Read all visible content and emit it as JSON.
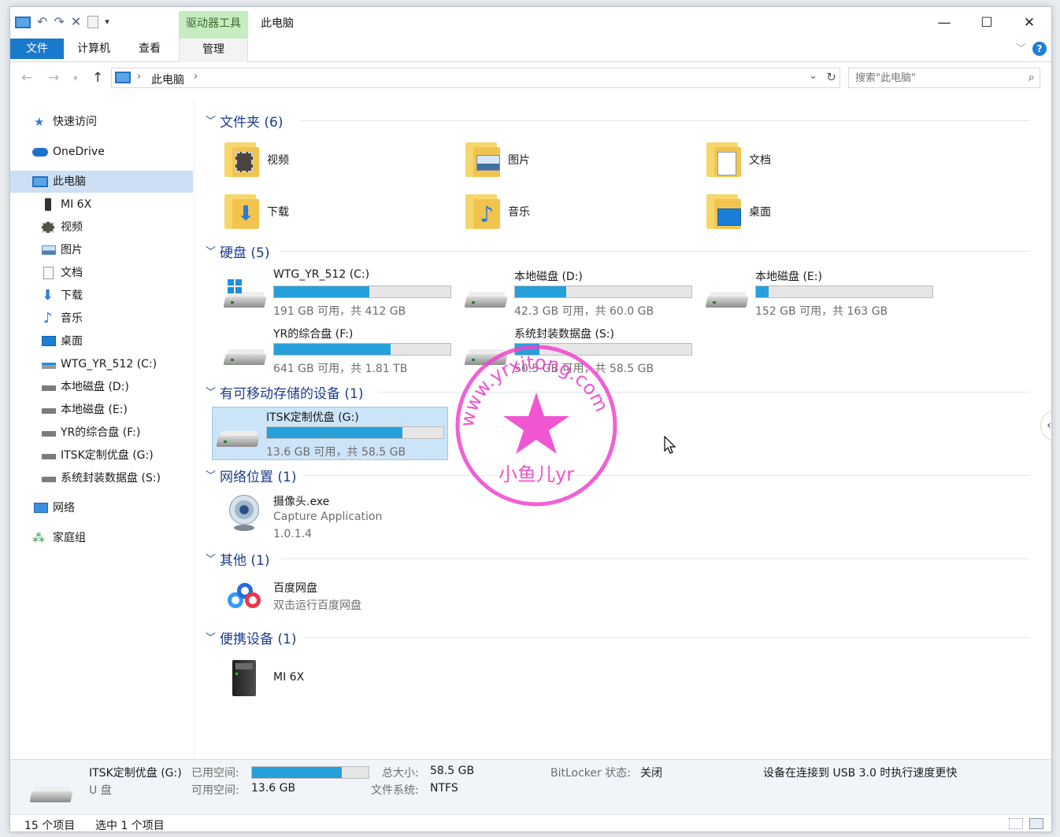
{
  "title_bar": {
    "context_tab": "驱动器工具",
    "window_title": "此电脑",
    "minimize_label": "—",
    "maximize_label": "☐",
    "close_label": "✕"
  },
  "ribbon": {
    "file": "文件",
    "computer": "计算机",
    "view": "查看",
    "manage": "管理",
    "help": "?"
  },
  "address": {
    "crumb": "此电脑",
    "search_placeholder": "搜索\"此电脑\""
  },
  "sidebar": {
    "items": [
      {
        "label": "快速访问"
      },
      {
        "label": "OneDrive"
      },
      {
        "label": "此电脑"
      },
      {
        "label": "MI 6X"
      },
      {
        "label": "视频"
      },
      {
        "label": "图片"
      },
      {
        "label": "文档"
      },
      {
        "label": "下载"
      },
      {
        "label": "音乐"
      },
      {
        "label": "桌面"
      },
      {
        "label": "WTG_YR_512 (C:)"
      },
      {
        "label": "本地磁盘 (D:)"
      },
      {
        "label": "本地磁盘 (E:)"
      },
      {
        "label": "YR的综合盘 (F:)"
      },
      {
        "label": "ITSK定制优盘 (G:)"
      },
      {
        "label": "系统封装数据盘 (S:)"
      },
      {
        "label": "网络"
      },
      {
        "label": "家庭组"
      }
    ]
  },
  "groups": {
    "folders": "文件夹 (6)",
    "disks": "硬盘 (5)",
    "removable": "有可移动存储的设备 (1)",
    "network": "网络位置 (1)",
    "other": "其他 (1)",
    "portable": "便携设备 (1)"
  },
  "folders": [
    {
      "label": "视频",
      "icon": "video-folder-icon"
    },
    {
      "label": "图片",
      "icon": "pictures-folder-icon"
    },
    {
      "label": "文档",
      "icon": "documents-folder-icon"
    },
    {
      "label": "下载",
      "icon": "downloads-folder-icon"
    },
    {
      "label": "音乐",
      "icon": "music-folder-icon"
    },
    {
      "label": "桌面",
      "icon": "desktop-folder-icon"
    }
  ],
  "drives": [
    {
      "name": "WTG_YR_512 (C:)",
      "size": "191 GB 可用，共 412 GB",
      "used_fraction": 0.54
    },
    {
      "name": "本地磁盘 (D:)",
      "size": "42.3 GB 可用，共 60.0 GB",
      "used_fraction": 0.29
    },
    {
      "name": "本地磁盘 (E:)",
      "size": "152 GB 可用，共 163 GB",
      "used_fraction": 0.07
    },
    {
      "name": "YR的综合盘 (F:)",
      "size": "641 GB 可用，共 1.81 TB",
      "used_fraction": 0.66
    },
    {
      "name": "系统封装数据盘 (S:)",
      "size": "50.5 GB 可用，共 58.5 GB",
      "used_fraction": 0.14
    }
  ],
  "removable": {
    "name": "ITSK定制优盘 (G:)",
    "size": "13.6 GB 可用，共 58.5 GB",
    "used_fraction": 0.77
  },
  "network_item": {
    "name": "摄像头.exe",
    "desc": "Capture Application",
    "version": "1.0.1.4"
  },
  "other_item": {
    "name": "百度网盘",
    "desc": "双击运行百度网盘"
  },
  "portable_item": {
    "name": "MI 6X"
  },
  "details": {
    "name": "ITSK定制优盘 (G:)",
    "type": "U 盘",
    "used_label": "已用空间:",
    "free_label": "可用空间:",
    "free_value": "13.6 GB",
    "total_label": "总大小:",
    "total_value": "58.5 GB",
    "fs_label": "文件系统:",
    "fs_value": "NTFS",
    "bitlocker_label": "BitLocker 状态:",
    "bitlocker_value": "关闭",
    "usb_note": "设备在连接到 USB 3.0 时执行速度更快",
    "used_fraction": 0.77
  },
  "status": {
    "count": "15 个项目",
    "selected": "选中 1 个项目"
  },
  "watermark": {
    "top_text": "www.yrxitong.com",
    "bottom_text": "小鱼儿yr"
  },
  "colors": {
    "accent": "#1979ca",
    "bar_fill": "#26a0da",
    "selection": "#cce4f7",
    "context_tab": "#c8ecc2",
    "watermark": "#ee44cc"
  }
}
